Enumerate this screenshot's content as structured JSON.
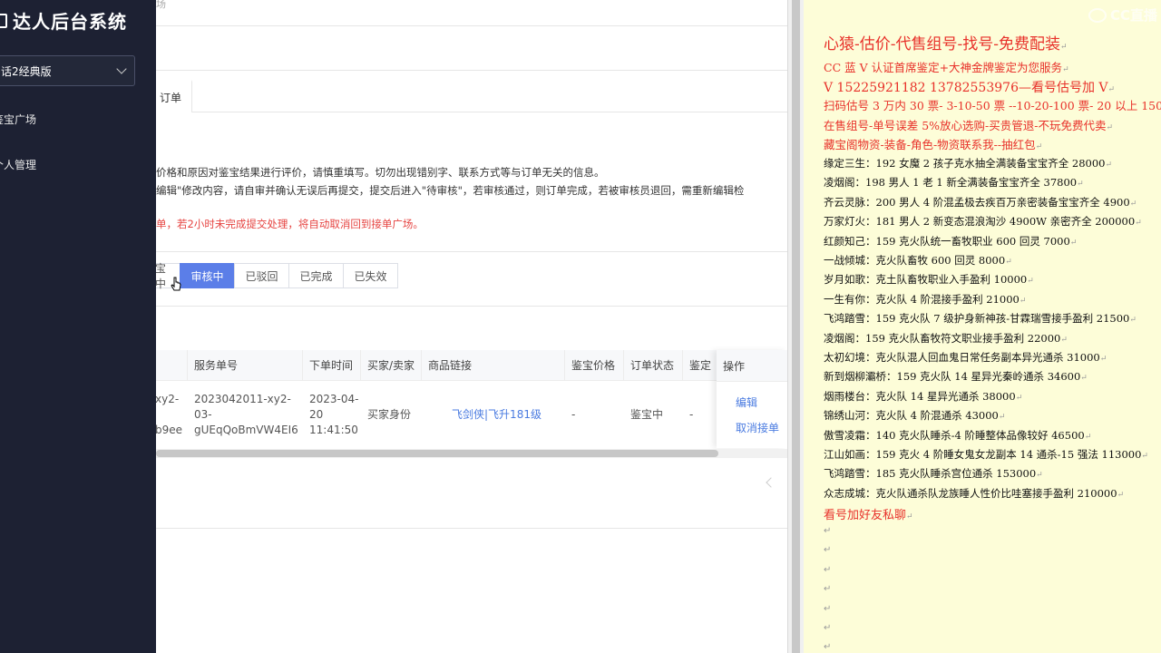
{
  "app": {
    "title": "达人后台系统",
    "version_select": "话2经典版",
    "nav": [
      "鉴宝广场",
      "个人管理"
    ]
  },
  "main": {
    "breadcrumb": "场",
    "tab": "订单",
    "notices": [
      "价格和原因对鉴宝结果进行评价，请慎重填写。切勿出现错别字、联系方式等与订单无关的信息。",
      "编辑\"修改内容，请自审并确认无误后再提交，提交后进入\"待审核\"，若审核通过，则订单完成，若被审核员退回，需重新编辑检",
      "单，若2小时未完成提交处理，将自动取消回到接单广场。"
    ],
    "filters": [
      "宝中",
      "审核中",
      "已驳回",
      "已完成",
      "已失效"
    ],
    "active_filter": "审核中",
    "table": {
      "headers": [
        "服务单号",
        "下单时间",
        "买家/卖家",
        "商品链接",
        "鉴宝价格",
        "订单状态",
        "鉴定",
        "操作"
      ],
      "row": {
        "partial_id": [
          "xy2-",
          "b9ee"
        ],
        "service_no": [
          "2023042011-xy2-",
          "03-",
          "gUEqQoBmVW4EI6"
        ],
        "time": [
          "2023-04-",
          "20",
          "11:41:50"
        ],
        "role": "买家身份",
        "link": "飞剑侠|飞升181级",
        "price": "-",
        "status": "鉴宝中",
        "appraise": "-",
        "ops": [
          "编辑",
          "取消接单"
        ]
      }
    }
  },
  "doc": {
    "watermark": "CC直播",
    "colors": {
      "red": "#e8312a",
      "black": "#111111"
    },
    "lines": [
      {
        "text": "心猿-估价-代售组号-找号-免费配装",
        "color": "red"
      },
      {
        "text": "CC 蓝 V 认证首席鉴定+大神金牌鉴定为您服务",
        "color": "red"
      },
      {
        "text": "V 15225921182      13782553976—看号估号加 V",
        "color": "red"
      },
      {
        "text": "扫码估号 3 万内 30 票- 3-10-50 票  --10-20-100 票- 20 以上 150",
        "color": "red"
      },
      {
        "text": "在售组号-单号误差 5%放心选购-买贵管退-不玩免费代卖",
        "color": "red"
      },
      {
        "text": "藏宝阁物资-装备-角色-物资联系我--抽红包",
        "color": "red"
      },
      {
        "text": "缘定三生：192 女魔 2 孩子克水抽全满装备宝宝齐全 28000",
        "color": "black"
      },
      {
        "text": "凌烟阁：198 男人 1 老 1 新全满装备宝宝齐全 37800",
        "color": "black"
      },
      {
        "text": "齐云灵脉：200 男人 4 阶混孟极去疾百万亲密装备宝宝齐全 4900",
        "color": "black"
      },
      {
        "text": "万家灯火：181 男人 2 新变态混浪淘沙 4900W 亲密齐全 200000",
        "color": "black"
      },
      {
        "text": "红颜知己：159 克火队统一畜牧职业 600 回灵 7000",
        "color": "black"
      },
      {
        "text": "一战倾城：克火队畜牧 600 回灵 8000",
        "color": "black"
      },
      {
        "text": "岁月如歌：克土队畜牧职业入手盈利 10000",
        "color": "black"
      },
      {
        "text": "一生有你：克火队 4 阶混接手盈利 21000",
        "color": "black"
      },
      {
        "text": "飞鸿踏雪：159 克火队 7 级护身新神孩-甘霖瑞雪接手盈利 21500",
        "color": "black"
      },
      {
        "text": "凌烟阁：159 克火队畜牧符文职业接手盈利 22000",
        "color": "black"
      },
      {
        "text": "太初幻境：克火队混人回血鬼日常任务副本异光通杀 31000",
        "color": "black"
      },
      {
        "text": "新到烟柳灞桥：159 克火队 14 星异光秦岭通杀 34600",
        "color": "black"
      },
      {
        "text": "烟雨楼台：克火队 14 星异光通杀 38000",
        "color": "black"
      },
      {
        "text": "锦绣山河：克火队 4 阶混通杀 43000",
        "color": "black"
      },
      {
        "text": "傲雪凌霜：140 克火队睡杀-4 阶睡整体品像较好 46500",
        "color": "black"
      },
      {
        "text": "江山如画：159 克火 4 阶睡女鬼女龙副本 14 通杀-15 强法 113000",
        "color": "black"
      },
      {
        "text": "飞鸿踏雪：185 克火队睡杀宫位通杀 153000",
        "color": "black"
      },
      {
        "text": "众志成城：克火队通杀队龙族睡人性价比哇塞接手盈利 210000",
        "color": "black"
      },
      {
        "text": "看号加好友私聊",
        "color": "red"
      }
    ],
    "paragraph_mark": "↵"
  }
}
